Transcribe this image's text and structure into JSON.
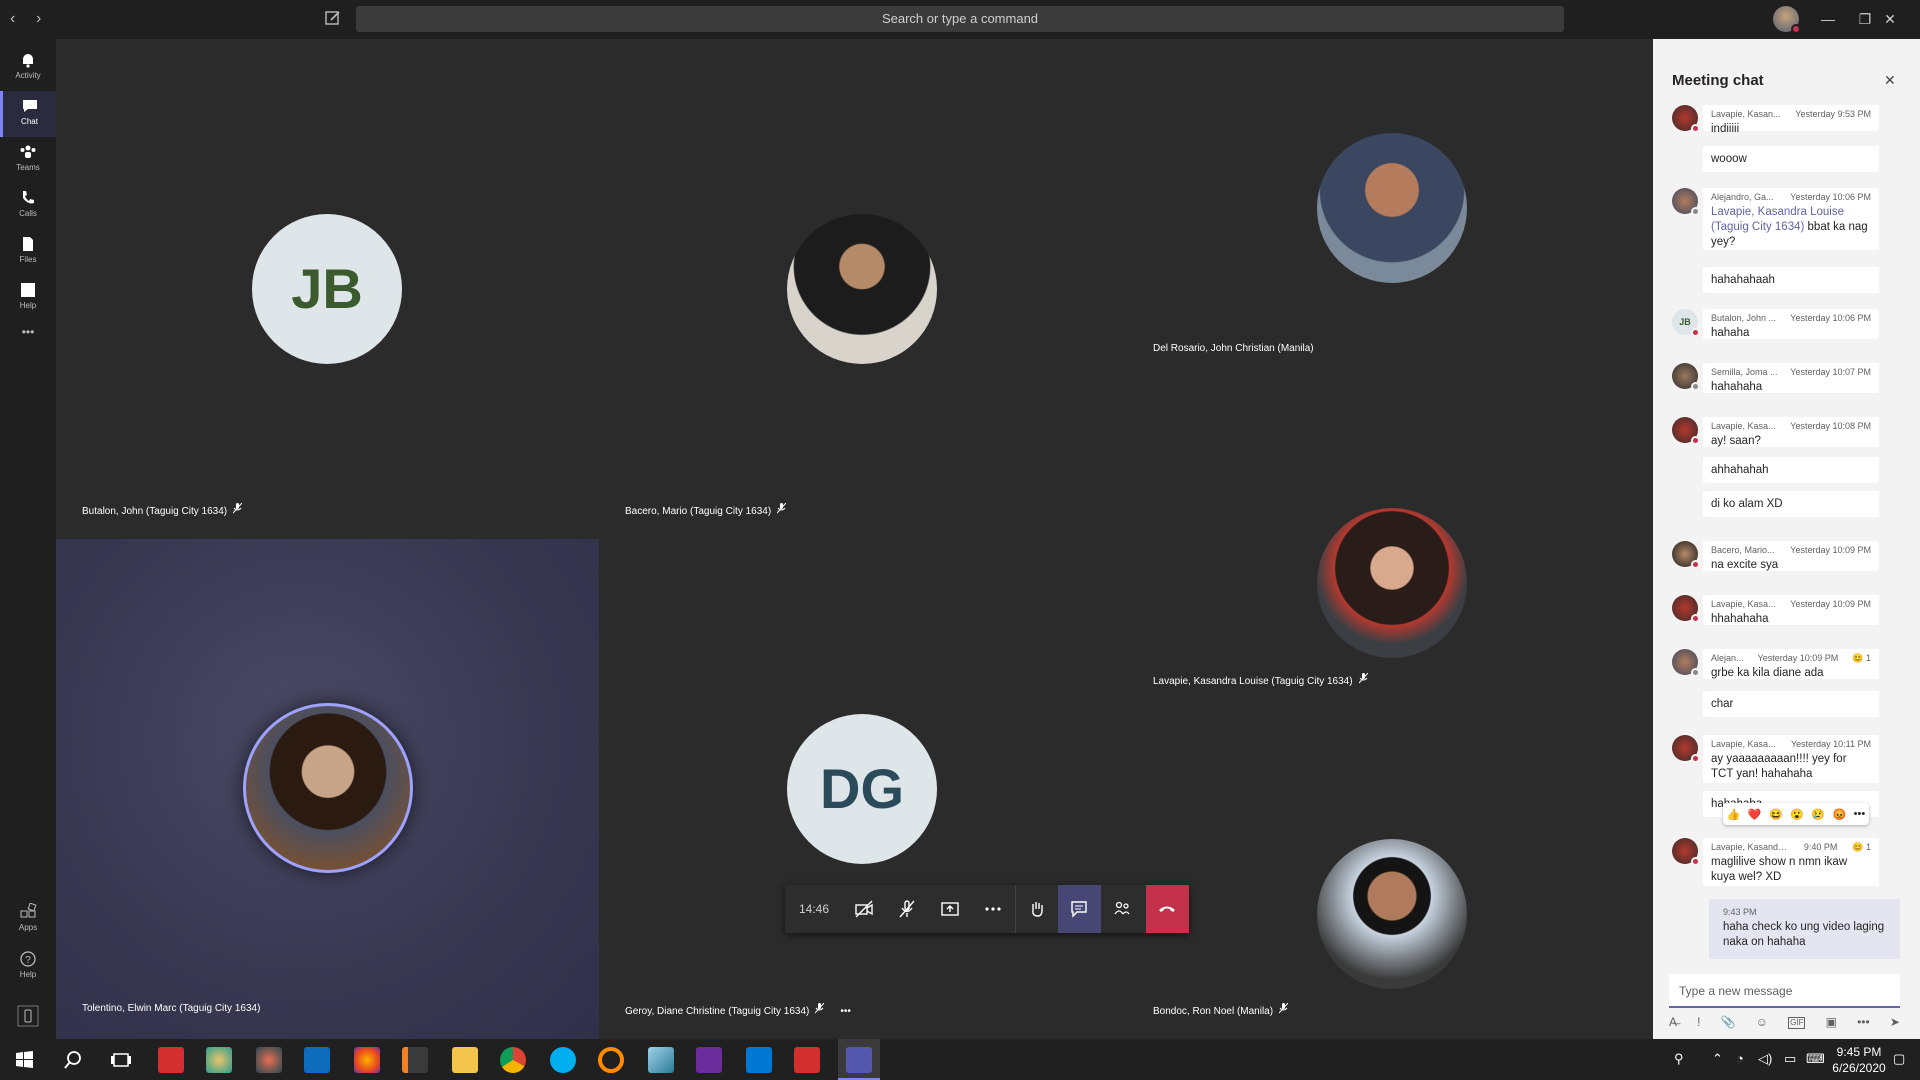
{
  "titlebar": {
    "back": "‹",
    "forward": "›",
    "search_placeholder": "Search or type a command",
    "minimize": "—",
    "maximize": "❐",
    "close": "✕"
  },
  "rail": [
    {
      "label": "Activity",
      "icon": "bell-icon"
    },
    {
      "label": "Chat",
      "icon": "chat-icon",
      "active": true
    },
    {
      "label": "Teams",
      "icon": "teams-icon"
    },
    {
      "label": "Calls",
      "icon": "phone-icon"
    },
    {
      "label": "Files",
      "icon": "file-icon"
    },
    {
      "label": "Help",
      "icon": "help-icon"
    }
  ],
  "rail_more": "•••",
  "rail_bottom": [
    {
      "label": "Apps",
      "icon": "apps-icon"
    },
    {
      "label": "Help",
      "icon": "help-icon"
    }
  ],
  "participants": [
    {
      "name": "Butalon, John (Taguig City 1634)",
      "initials": "JB",
      "muted": true
    },
    {
      "name": "Bacero, Mario (Taguig City 1634)",
      "muted": true
    },
    {
      "name": "Del Rosario, John Christian (Manila)",
      "muted": false
    },
    {
      "name": "Lavapie, Kasandra Louise (Taguig City 1634)",
      "muted": true
    },
    {
      "name": "Tolentino, Elwin Marc (Taguig City 1634)",
      "muted": false
    },
    {
      "name": "Geroy, Diane Christine (Taguig City 1634)",
      "initials": "DG",
      "muted": true,
      "more": "•••"
    },
    {
      "name": "Bondoc, Ron Noel (Manila)",
      "muted": true
    }
  ],
  "controls": {
    "timer": "14:46"
  },
  "chat": {
    "title": "Meeting chat",
    "messages": [
      {
        "who": "Lavapie, Kasan...",
        "time": "Yesterday 9:53 PM",
        "text": "indiiiii"
      },
      {
        "text": "wooow"
      },
      {
        "who": "Alejandro, Ga...",
        "time": "Yesterday 10:06 PM",
        "mention": "Lavapie, Kasandra Louise (Taguig City 1634)",
        "text": " bbat ka nag yey?"
      },
      {
        "text": "hahahahaah"
      },
      {
        "who": "Butalon, John ...",
        "time": "Yesterday 10:06 PM",
        "text": "hahaha",
        "initials": "JB"
      },
      {
        "who": "Semilla, Joma ...",
        "time": "Yesterday 10:07 PM",
        "text": "hahahaha"
      },
      {
        "who": "Lavapie, Kasa...",
        "time": "Yesterday 10:08 PM",
        "text": "ay! saan?"
      },
      {
        "text": "ahhahahah"
      },
      {
        "text": "di ko alam XD"
      },
      {
        "who": "Bacero, Mario...",
        "time": "Yesterday 10:09 PM",
        "text": "na excite sya"
      },
      {
        "who": "Lavapie, Kasa...",
        "time": "Yesterday 10:09 PM",
        "text": "hhahahaha"
      },
      {
        "who": "Alejan...",
        "time": "Yesterday 10:09 PM",
        "text": "grbe ka kila diane ada",
        "reaction": "😊 1"
      },
      {
        "text": "char"
      },
      {
        "who": "Lavapie, Kasa...",
        "time": "Yesterday 10:11 PM",
        "text": "ay yaaaaaaaaan!!!! yey for TCT yan! hahahaha"
      },
      {
        "text": "hahahaha"
      },
      {
        "who": "Lavapie, Kasandra ...",
        "time": "9:40 PM",
        "text": "maglilive show n nmn ikaw kuya wel? XD",
        "reaction": "😊 1"
      }
    ],
    "reactions": [
      "👍",
      "❤️",
      "😆",
      "😮",
      "😢",
      "😡",
      "•••"
    ],
    "my_message": {
      "time": "9:43 PM",
      "text": "haha check ko ung video laging naka on hahaha"
    },
    "compose_placeholder": "Type a new message",
    "tools": [
      "A̶",
      "!",
      "📎",
      "☺",
      "GIF",
      "▣",
      "•••",
      "➤"
    ]
  },
  "taskbar": {
    "time": "9:45 PM",
    "date": "6/26/2020"
  }
}
